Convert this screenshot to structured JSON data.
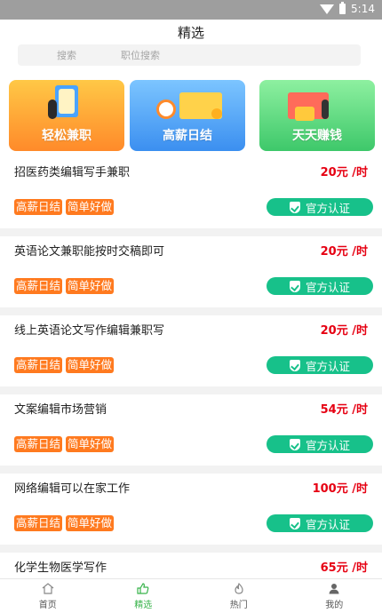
{
  "status_bar": {
    "time": "5:14",
    "icons": [
      "wifi-icon",
      "battery-icon"
    ]
  },
  "header": {
    "title": "精选"
  },
  "search": {
    "hint_left": "搜索",
    "hint_right": "职位搜索"
  },
  "banners": [
    {
      "label": "轻松兼职",
      "icon": "hourglass-illustration"
    },
    {
      "label": "高薪日结",
      "icon": "money-illustration"
    },
    {
      "label": "天天赚钱",
      "icon": "coins-illustration"
    }
  ],
  "jobs": [
    {
      "title": "招医药类编辑写手兼职",
      "salary": "20元 /时",
      "tags": [
        "高薪日结",
        "简单好做"
      ],
      "verify": "官方认证"
    },
    {
      "title": "英语论文兼职能按时交稿即可",
      "salary": "20元 /时",
      "tags": [
        "高薪日结",
        "简单好做"
      ],
      "verify": "官方认证"
    },
    {
      "title": "线上英语论文写作编辑兼职写",
      "salary": "20元 /时",
      "tags": [
        "高薪日结",
        "简单好做"
      ],
      "verify": "官方认证"
    },
    {
      "title": "文案编辑市场营销",
      "salary": "54元 /时",
      "tags": [
        "高薪日结",
        "简单好做"
      ],
      "verify": "官方认证"
    },
    {
      "title": "网络编辑可以在家工作",
      "salary": "100元 /时",
      "tags": [
        "高薪日结",
        "简单好做"
      ],
      "verify": "官方认证"
    },
    {
      "title": "化学生物医学写作",
      "salary": "65元 /时",
      "tags": [],
      "verify": ""
    }
  ],
  "tabbar": {
    "items": [
      {
        "label": "首页",
        "icon": "home-icon"
      },
      {
        "label": "精选",
        "icon": "thumbs-up-icon",
        "active": true
      },
      {
        "label": "热门",
        "icon": "fire-icon"
      },
      {
        "label": "我的",
        "icon": "person-icon"
      }
    ]
  },
  "colors": {
    "accent_green": "#37b34a",
    "salary_red": "#e60012",
    "tag_orange": "#ff7a1f",
    "verify_green": "#17c18a"
  }
}
